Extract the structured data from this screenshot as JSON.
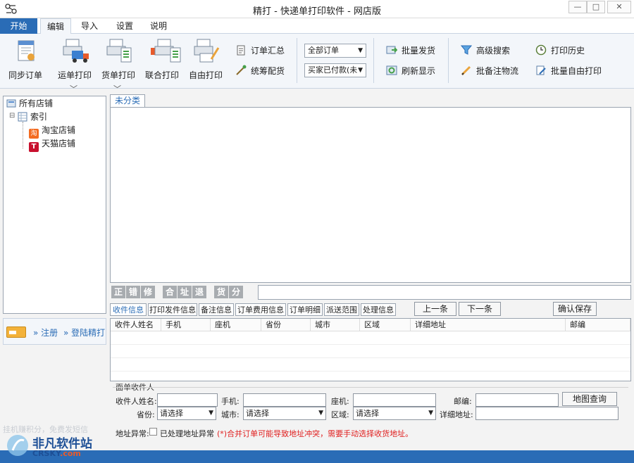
{
  "window": {
    "title": "精打 - 快递单打印软件 - 网店版",
    "min": "—",
    "max": "□",
    "close": "✕"
  },
  "tabs": [
    "开始",
    "编辑",
    "导入",
    "设置",
    "说明"
  ],
  "ribbon": {
    "big_buttons": [
      "同步订单",
      "运单打印",
      "货单打印",
      "联合打印",
      "自由打印"
    ],
    "small_buttons": [
      "订单汇总",
      "统筹配货"
    ],
    "filters": [
      "全部订单",
      "买家已付款(未"
    ],
    "actions": [
      "批量发货",
      "刷新显示",
      "高级搜索",
      "批备注物流",
      "打印历史",
      "批量自由打印"
    ],
    "chevron": "﹀"
  },
  "tree": {
    "root": "所有店铺",
    "index": "索引",
    "shops": [
      "淘宝店铺",
      "天猫店铺"
    ],
    "taobao_badge": "淘",
    "tmall_badge": "T"
  },
  "login": {
    "register": "注册",
    "login": "登陆精打",
    "arrow": "»"
  },
  "promo": "挂机赚积分，免费发短信",
  "main_tab": "未分类",
  "marks": [
    "正",
    "错",
    "修",
    "合",
    "址",
    "退",
    "货",
    "分"
  ],
  "detail_tabs": [
    "收件信息",
    "打印发件信息",
    "备注信息",
    "订单费用信息",
    "订单明细",
    "派送范围",
    "处理信息"
  ],
  "nav_buttons": {
    "prev": "上一条",
    "next": "下一条",
    "save": "确认保存"
  },
  "grid_columns": [
    "收件人姓名",
    "手机",
    "座机",
    "省份",
    "城市",
    "区域",
    "详细地址",
    "邮编"
  ],
  "form": {
    "section": "面单收件人",
    "name_label": "收件人姓名:",
    "mobile_label": "手机:",
    "phone_label": "座机:",
    "zip_label": "邮编:",
    "map_button": "地图查询",
    "province_label": "省份:",
    "city_label": "城市:",
    "area_label": "区域:",
    "address_label": "详细地址:",
    "select_placeholder": "请选择",
    "addr_error_label": "地址异常:",
    "addr_checkbox_label": "已处理地址异常",
    "warning": "(*)合并订单可能导致地址冲突，需要手动选择收货地址。"
  },
  "watermark": {
    "site": "非凡软件站",
    "domain": "CRSKY",
    "suffix": ".com"
  },
  "colors": {
    "accent": "#2a6cb6",
    "warning": "#e02020"
  }
}
